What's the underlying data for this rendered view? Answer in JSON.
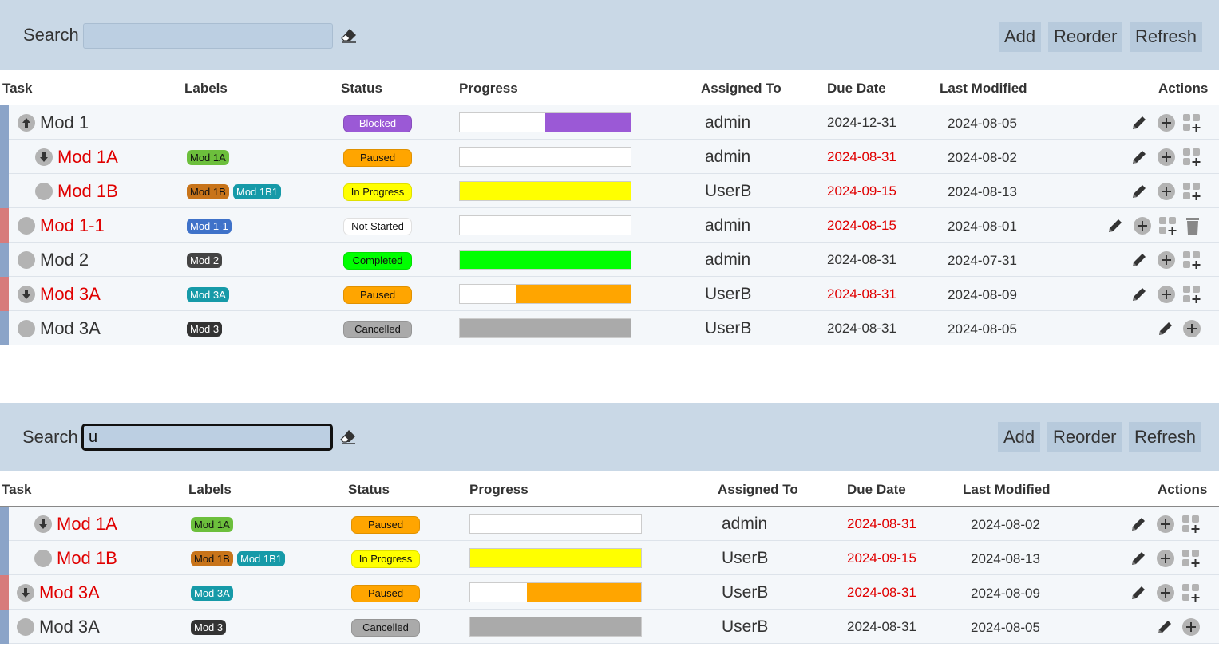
{
  "toolbar_top": {
    "search_label": "Search",
    "search_value": "",
    "add_label": "Add",
    "reorder_label": "Reorder",
    "refresh_label": "Refresh"
  },
  "toolbar_bottom": {
    "search_label": "Search",
    "search_value": "u",
    "add_label": "Add",
    "reorder_label": "Reorder",
    "refresh_label": "Refresh"
  },
  "columns": {
    "task": "Task",
    "labels": "Labels",
    "status": "Status",
    "progress": "Progress",
    "assigned": "Assigned To",
    "due": "Due Date",
    "modified": "Last Modified",
    "actions": "Actions"
  },
  "colors": {
    "toolbar_bg": "#c9d8e6",
    "blocked": "#9b59d6",
    "paused": "#ffa500",
    "in_progress": "#ffff00",
    "not_started": "#ffffff",
    "completed": "#00ff00",
    "cancelled": "#aaaaaa",
    "overdue_text": "#e00000"
  },
  "rows_top": [
    {
      "name": "Mod 1",
      "icon": "arrow-up-icon",
      "labels": [],
      "status": "Blocked",
      "progress": 0.5,
      "assigned": "admin",
      "due": "2024-12-31",
      "modified": "2024-08-05"
    },
    {
      "name": "Mod 1A",
      "icon": "arrow-down-icon",
      "labels": [
        "Mod 1A"
      ],
      "status": "Paused",
      "progress": 0.0,
      "assigned": "admin",
      "due": "2024-08-31",
      "modified": "2024-08-02"
    },
    {
      "name": "Mod 1B",
      "icon": "circle-icon",
      "labels": [
        "Mod 1B",
        "Mod 1B1"
      ],
      "status": "In Progress",
      "progress": 1.0,
      "assigned": "UserB",
      "due": "2024-09-15",
      "modified": "2024-08-13"
    },
    {
      "name": "Mod 1-1",
      "icon": "circle-icon",
      "labels": [
        "Mod 1-1"
      ],
      "status": "Not Started",
      "progress": 0.0,
      "assigned": "admin",
      "due": "2024-08-15",
      "modified": "2024-08-01"
    },
    {
      "name": "Mod 2",
      "icon": "circle-icon",
      "labels": [
        "Mod 2"
      ],
      "status": "Completed",
      "progress": 1.0,
      "assigned": "admin",
      "due": "2024-08-31",
      "modified": "2024-07-31"
    },
    {
      "name": "Mod 3A",
      "icon": "arrow-down-icon",
      "labels": [
        "Mod 3A"
      ],
      "status": "Paused",
      "progress": 0.67,
      "assigned": "UserB",
      "due": "2024-08-31",
      "modified": "2024-08-09"
    },
    {
      "name": "Mod 3A",
      "icon": "circle-icon",
      "labels": [
        "Mod 3"
      ],
      "status": "Cancelled",
      "progress": 1.0,
      "assigned": "UserB",
      "due": "2024-08-31",
      "modified": "2024-08-05"
    }
  ],
  "rows_bottom": [
    {
      "name": "Mod 1A",
      "icon": "arrow-down-icon",
      "labels": [
        "Mod 1A"
      ],
      "status": "Paused",
      "progress": 0.0,
      "assigned": "admin",
      "due": "2024-08-31",
      "modified": "2024-08-02"
    },
    {
      "name": "Mod 1B",
      "icon": "circle-icon",
      "labels": [
        "Mod 1B",
        "Mod 1B1"
      ],
      "status": "In Progress",
      "progress": 1.0,
      "assigned": "UserB",
      "due": "2024-09-15",
      "modified": "2024-08-13"
    },
    {
      "name": "Mod 3A",
      "icon": "arrow-down-icon",
      "labels": [
        "Mod 3A"
      ],
      "status": "Paused",
      "progress": 0.67,
      "assigned": "UserB",
      "due": "2024-08-31",
      "modified": "2024-08-09"
    },
    {
      "name": "Mod 3A",
      "icon": "circle-icon",
      "labels": [
        "Mod 3"
      ],
      "status": "Cancelled",
      "progress": 1.0,
      "assigned": "UserB",
      "due": "2024-08-31",
      "modified": "2024-08-05"
    }
  ]
}
